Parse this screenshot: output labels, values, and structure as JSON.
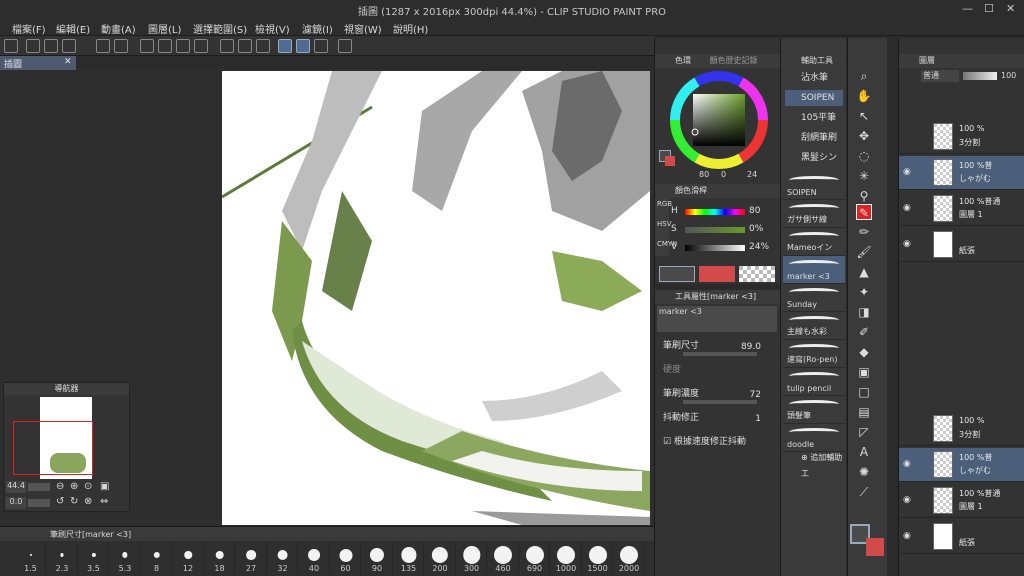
{
  "window": {
    "title": "插圖 (1287 x 2016px 300dpi 44.4%) - CLIP STUDIO PAINT PRO"
  },
  "menu": [
    "檔案(F)",
    "編輯(E)",
    "動畫(A)",
    "圖層(L)",
    "選擇範圍(S)",
    "檢視(V)",
    "濾鏡(I)",
    "視窗(W)",
    "說明(H)"
  ],
  "canvas_tab": {
    "label": "插圖"
  },
  "navigator": {
    "title": "導航器",
    "zoom": "44.4",
    "rotation": "0.0"
  },
  "brush_size_panel": {
    "title": "筆刷尺寸[marker <3]",
    "sizes": [
      "1.5",
      "2.3",
      "3.5",
      "5.3",
      "8",
      "12",
      "18",
      "27",
      "32",
      "40",
      "60",
      "90",
      "135",
      "200",
      "300",
      "460",
      "690",
      "1000",
      "1500",
      "2000"
    ]
  },
  "color_panel": {
    "tabs": [
      "色環",
      "顏色歷史記錄"
    ],
    "hsv": {
      "h": "80",
      "s": "0",
      "v": "24"
    },
    "slider_title": "顏色滑桿",
    "sliders": [
      {
        "label": "H",
        "value": "80"
      },
      {
        "label": "S",
        "value": "0%"
      },
      {
        "label": "V",
        "value": "24%"
      }
    ],
    "side_tabs": [
      "RGB",
      "HSV",
      "CMYK"
    ],
    "main_color": "#4a4a4a",
    "sub_color": "#d24a4a"
  },
  "tool_property": {
    "title": "工具屬性[marker <3]",
    "preset": "marker <3",
    "rows": [
      {
        "label": "筆刷尺寸",
        "value": "89.0"
      },
      {
        "label": "硬度",
        "value": ""
      },
      {
        "label": "筆刷濃度",
        "value": "72"
      },
      {
        "label": "抖動修正",
        "value": "1"
      }
    ],
    "checkbox": "根據速度修正抖動"
  },
  "subtool": {
    "title": "輔助工具",
    "groups": [
      "沾水筆",
      "SOIPEN",
      "105平筆",
      "刮網筆刷",
      "黑髮シン"
    ],
    "brushes": [
      "SOIPEN",
      "ガサ側サ線",
      "Mameoイン",
      "marker <3",
      "Sunday",
      "主線も水彩",
      "速寫(Ro-pen)",
      "tulip pencil",
      "頭髮筆",
      "doodle"
    ],
    "add_label": "追加輔助工"
  },
  "layers": {
    "tab": "圖層",
    "blend": "普通",
    "opacity": "100",
    "rows": [
      {
        "t1": "100 %",
        "t2": "3分割"
      },
      {
        "t1": "100 %普",
        "t2": "しゃがむ"
      },
      {
        "t1": "100 %普通",
        "t2": "圖層 1"
      },
      {
        "t1": "",
        "t2": "紙張"
      }
    ],
    "rows2": [
      {
        "t1": "100 %",
        "t2": "3分割"
      },
      {
        "t1": "100 %普",
        "t2": "しゃがむ"
      },
      {
        "t1": "100 %普通",
        "t2": "圖層 1"
      },
      {
        "t1": "",
        "t2": "紙張"
      }
    ]
  },
  "icons": [
    "search-icon",
    "eyedropper-icon",
    "pen-icon",
    "pencil-icon",
    "brush-icon",
    "eraser-icon",
    "fill-icon",
    "gradient-icon",
    "text-icon",
    "hand-icon",
    "move-icon",
    "lasso-icon",
    "eye-icon",
    "lock-icon"
  ]
}
